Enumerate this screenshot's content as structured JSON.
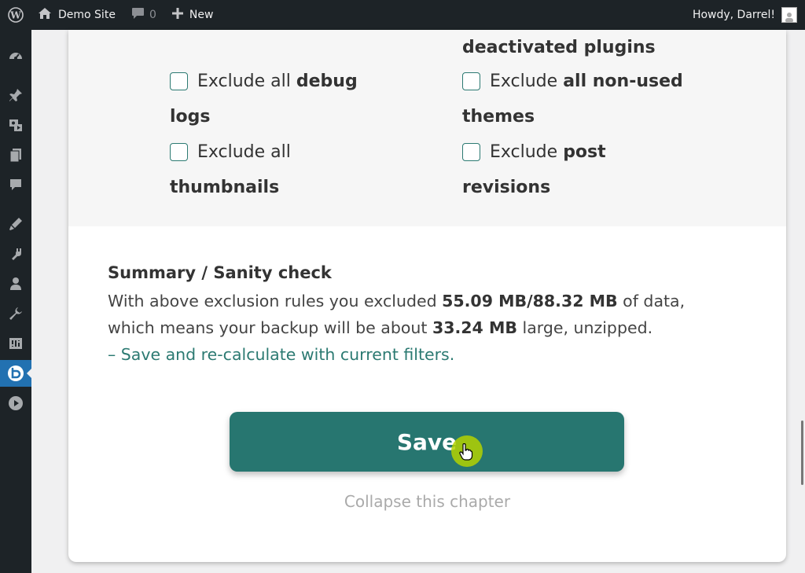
{
  "adminbar": {
    "site_name": "Demo Site",
    "comments_count": "0",
    "new_label": "New",
    "howdy": "Howdy, Darrel!"
  },
  "sidebar": {
    "icons": [
      "dashboard-icon",
      "pin-icon",
      "media-icon",
      "pages-icon",
      "comments-icon",
      "appearance-icon",
      "plugins-icon",
      "users-icon",
      "tools-icon",
      "settings-icon",
      "backup-plugin-icon",
      "play-icon"
    ],
    "active_index": 10
  },
  "options": {
    "right_top_continued": "deactivated plugins",
    "items": [
      {
        "pre": "Exclude all ",
        "bold": "debug",
        "cont": "logs"
      },
      {
        "pre": "Exclude ",
        "bold": "all non-used",
        "cont": "themes"
      },
      {
        "pre": "Exclude all",
        "bold": "",
        "cont": "thumbnails"
      },
      {
        "pre": "Exclude ",
        "bold": "post",
        "cont": "revisions"
      }
    ]
  },
  "summary": {
    "title": "Summary / Sanity check",
    "line1_pre": "With above exclusion rules you excluded ",
    "excluded": "55.09 MB",
    "slash": "/",
    "total": "88.32 MB",
    "line1_post": " of data,",
    "line2_pre": "which means your backup will be about ",
    "size": "33.24 MB",
    "line2_post": " large, unzipped.",
    "recalc_link": "– Save and re-calculate with current filters."
  },
  "actions": {
    "save_label": "Save",
    "collapse_label": "Collapse this chapter"
  },
  "colors": {
    "accent": "#277670",
    "link": "#2c7a72",
    "admin_bg": "#1d2327",
    "active": "#2271b1"
  }
}
